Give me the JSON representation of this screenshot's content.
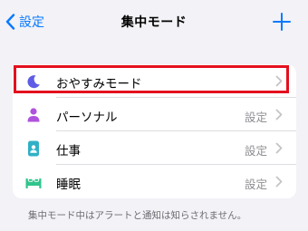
{
  "nav": {
    "back_label": "設定",
    "title": "集中モード",
    "add_icon": "plus-icon"
  },
  "focus_modes": [
    {
      "label": "おやすみモード",
      "icon": "moon-icon",
      "icon_color": "#5e5ce6",
      "detail": ""
    },
    {
      "label": "パーソナル",
      "icon": "person-icon",
      "icon_color": "#af52de",
      "detail": "設定"
    },
    {
      "label": "仕事",
      "icon": "badge-icon",
      "icon_color": "#30b0c7",
      "detail": "設定"
    },
    {
      "label": "睡眠",
      "icon": "bed-icon",
      "icon_color": "#30c48d",
      "detail": "設定"
    }
  ],
  "footer_text": "集中モード中はアラートと通知は知らされません。",
  "colors": {
    "accent": "#0a7aff",
    "highlight": "#e4101e"
  }
}
